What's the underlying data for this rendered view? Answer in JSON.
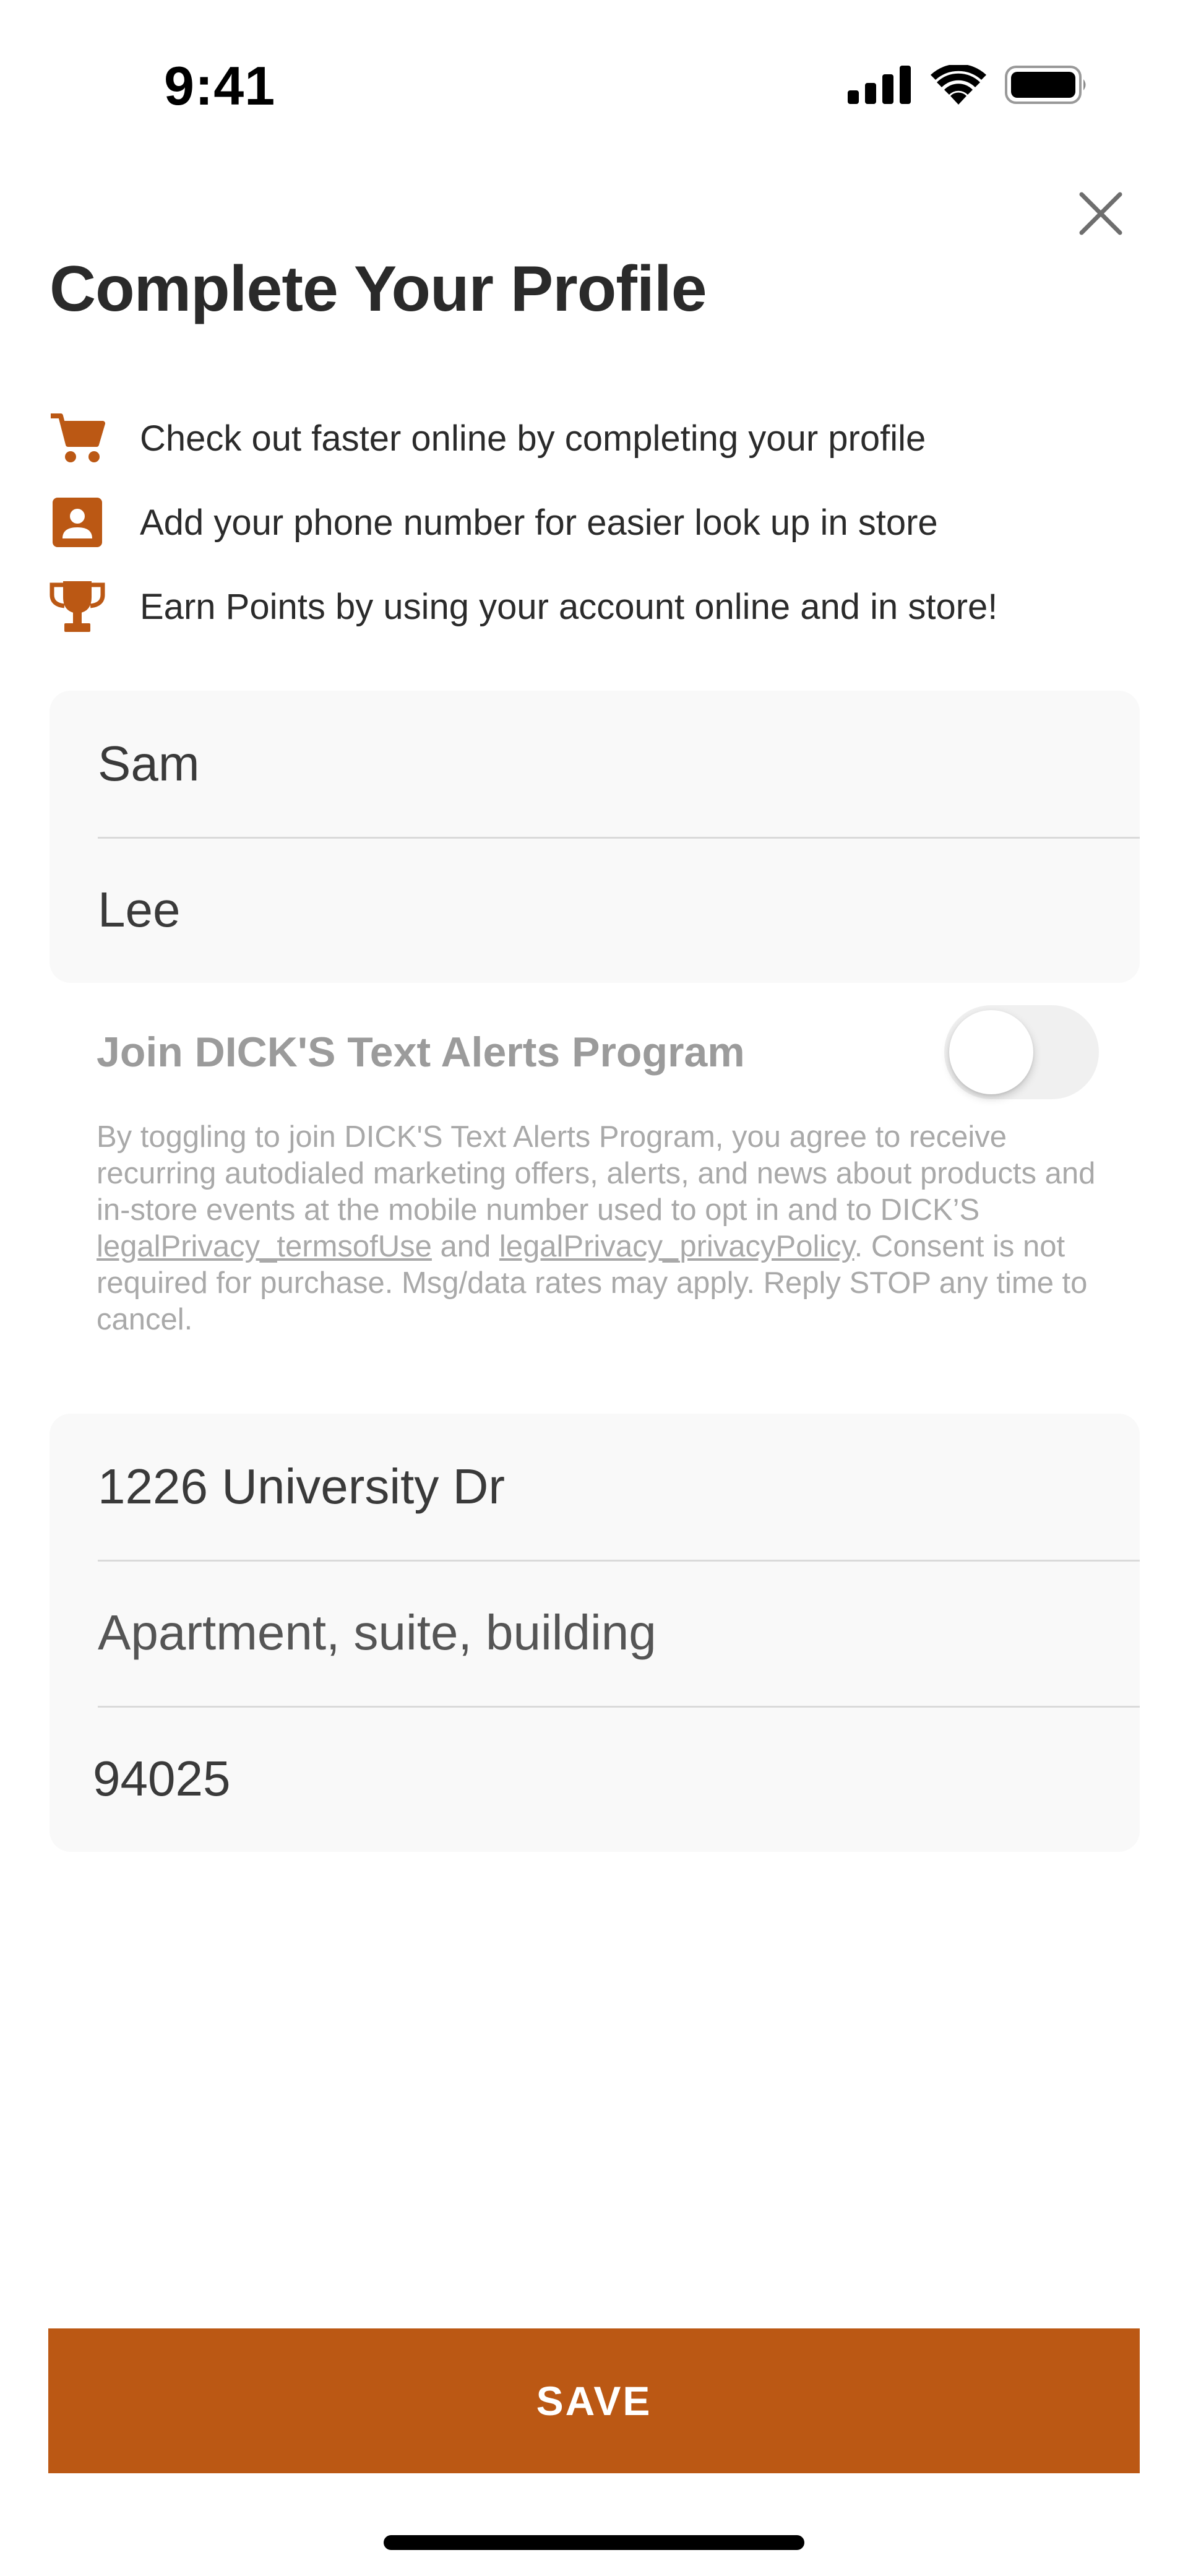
{
  "status_bar": {
    "time": "9:41",
    "icons": [
      "signal-icon",
      "wifi-icon",
      "battery-icon"
    ]
  },
  "header": {
    "title": "Complete Your Profile",
    "close_icon": "close-icon"
  },
  "benefits": [
    {
      "icon": "cart-icon",
      "text": "Check out faster online by completing your profile"
    },
    {
      "icon": "contact-icon",
      "text": "Add your phone number for easier look up in store"
    },
    {
      "icon": "trophy-icon",
      "text": "Earn Points by using your account online and in store!"
    }
  ],
  "name": {
    "first_name": "Sam",
    "last_name": "Lee"
  },
  "text_alerts": {
    "label": "Join DICK'S Text Alerts Program",
    "enabled": false,
    "legal_part1": "By toggling to join DICK'S Text Alerts Program, you agree to receive recurring autodialed marketing offers, alerts, and news about products and in-store events at the mobile number used to opt in and to DICK’S ",
    "terms_link": "legalPrivacy_termsofUse",
    "legal_and": " and ",
    "privacy_link": "legalPrivacy_privacyPolicy",
    "legal_part2": ". Consent is not required for purchase. Msg/data rates may apply. Reply STOP any time to cancel."
  },
  "address": {
    "street": "1226 University Dr",
    "apartment_placeholder": "Apartment, suite, building",
    "zip": "94025"
  },
  "footer": {
    "save_label": "SAVE"
  },
  "colors": {
    "accent": "#BB5814",
    "field_bg": "#F9F9F9",
    "muted_text": "#A9A9A9"
  }
}
